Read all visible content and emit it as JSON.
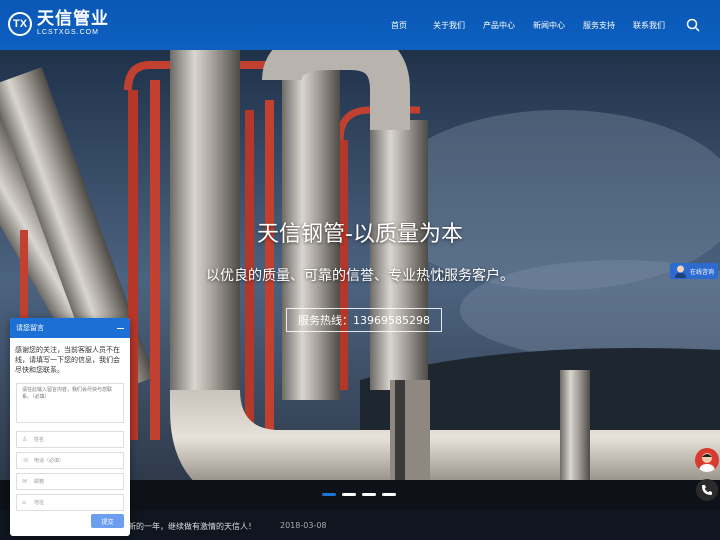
{
  "header": {
    "logo_mark": "TX",
    "logo_name": "天信管业",
    "logo_url": "LCSTXGS.COM",
    "nav": [
      "首页",
      "关于我们",
      "产品中心",
      "新闻中心",
      "服务支持",
      "联系我们"
    ]
  },
  "hero": {
    "title": "天信钢管-以质量为本",
    "subtitle": "以优良的质量、可靠的信誉、专业热忱服务客户。",
    "hotline": "服务热线：13969585298"
  },
  "ticker": {
    "text": "新的一年，继续做有激情的天信人！",
    "date": "2018-03-08"
  },
  "chat": {
    "title": "请您留言",
    "intro": "感谢您的关注，当前客服人员不在线，请填写一下您的信息，我们会尽快和您联系。",
    "textarea_placeholder": "请在此输入留言内容，我们会尽快与您联系。（必填）",
    "name_placeholder": "姓名",
    "phone_placeholder": "电话（必填）",
    "email_placeholder": "邮箱",
    "address_placeholder": "地址",
    "submit": "提交"
  },
  "float": {
    "consult": "在线咨询"
  },
  "colors": {
    "header_blue": "#0a58b5",
    "accent_blue": "#1b6fd5"
  }
}
